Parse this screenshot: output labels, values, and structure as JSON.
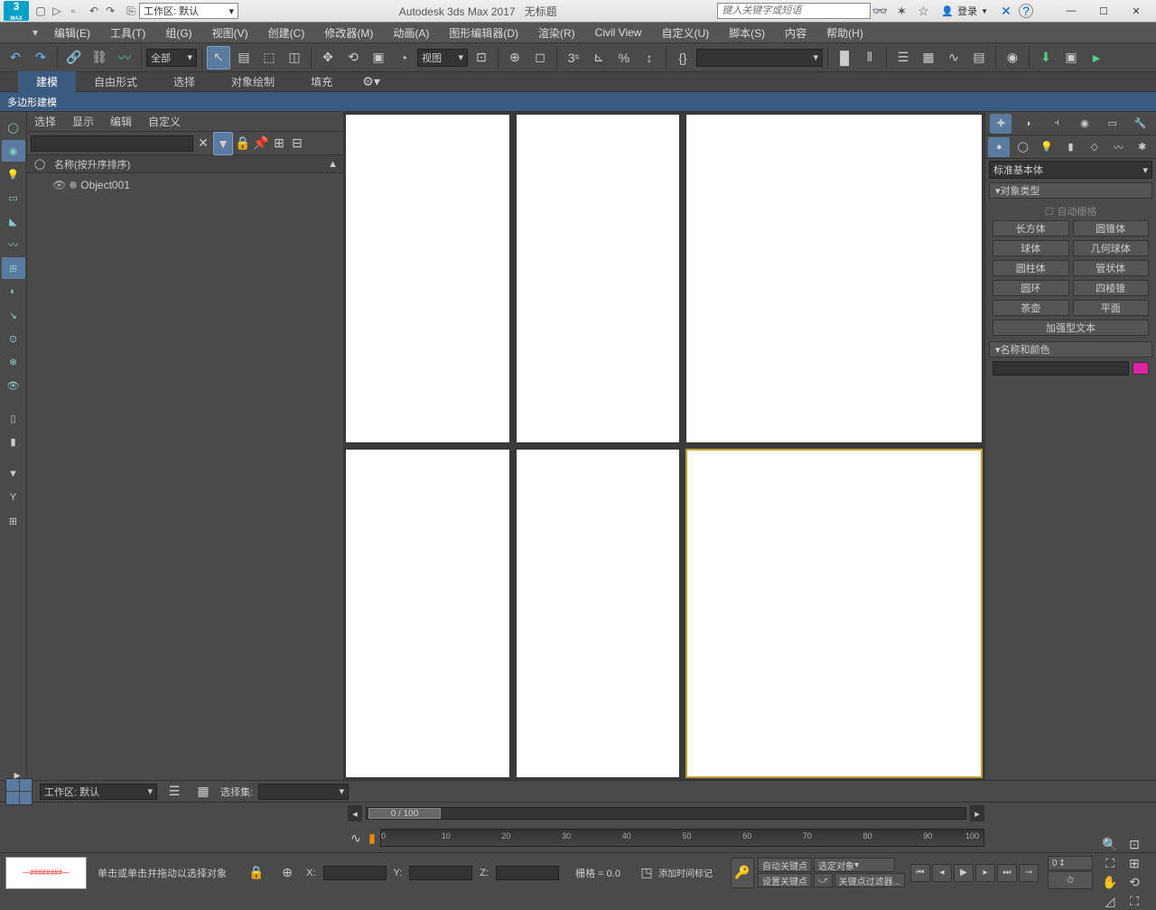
{
  "title": {
    "app": "Autodesk 3ds Max 2017",
    "doc": "无标题",
    "workspace_label": "工作区: 默认",
    "search_placeholder": "键入关键字或短语",
    "login": "登录"
  },
  "menubar": [
    "编辑(E)",
    "工具(T)",
    "组(G)",
    "视图(V)",
    "创建(C)",
    "修改器(M)",
    "动画(A)",
    "图形编辑器(D)",
    "渲染(R)",
    "Civil View",
    "自定义(U)",
    "脚本(S)",
    "内容",
    "帮助(H)"
  ],
  "toolbar": {
    "filter_dd": "全部",
    "view_dd": "视图"
  },
  "ribbon": {
    "tabs": [
      "建模",
      "自由形式",
      "选择",
      "对象绘制",
      "填充"
    ],
    "sub": "多边形建模"
  },
  "scene": {
    "tabs": [
      "选择",
      "显示",
      "编辑",
      "自定义"
    ],
    "header": "名称(按升序排序)",
    "items": [
      {
        "name": "Object001"
      }
    ]
  },
  "command": {
    "category_dd": "标准基本体",
    "rollout1": "对象类型",
    "autogrid": "自动栅格",
    "objects": [
      "长方体",
      "圆锥体",
      "球体",
      "几何球体",
      "圆柱体",
      "管状体",
      "圆环",
      "四棱锥",
      "茶壶",
      "平面",
      "加强型文本"
    ],
    "rollout2": "名称和颜色"
  },
  "timeline": {
    "slider": "0 / 100",
    "ticks": [
      "0",
      "10",
      "20",
      "30",
      "40",
      "50",
      "60",
      "70",
      "80",
      "90",
      "100"
    ]
  },
  "status": {
    "prompt": "单击或单击并拖动以选择对象",
    "x": "X:",
    "y": "Y:",
    "z": "Z:",
    "grid": "栅格 = 0.0",
    "add_time": "添加时间标记",
    "autokey": "自动关键点",
    "selected": "选定对象",
    "setkey": "设置关键点",
    "keyfilter": "关键点过滤器..."
  },
  "footer": {
    "workspace": "工作区: 默认",
    "selset": "选择集:"
  }
}
